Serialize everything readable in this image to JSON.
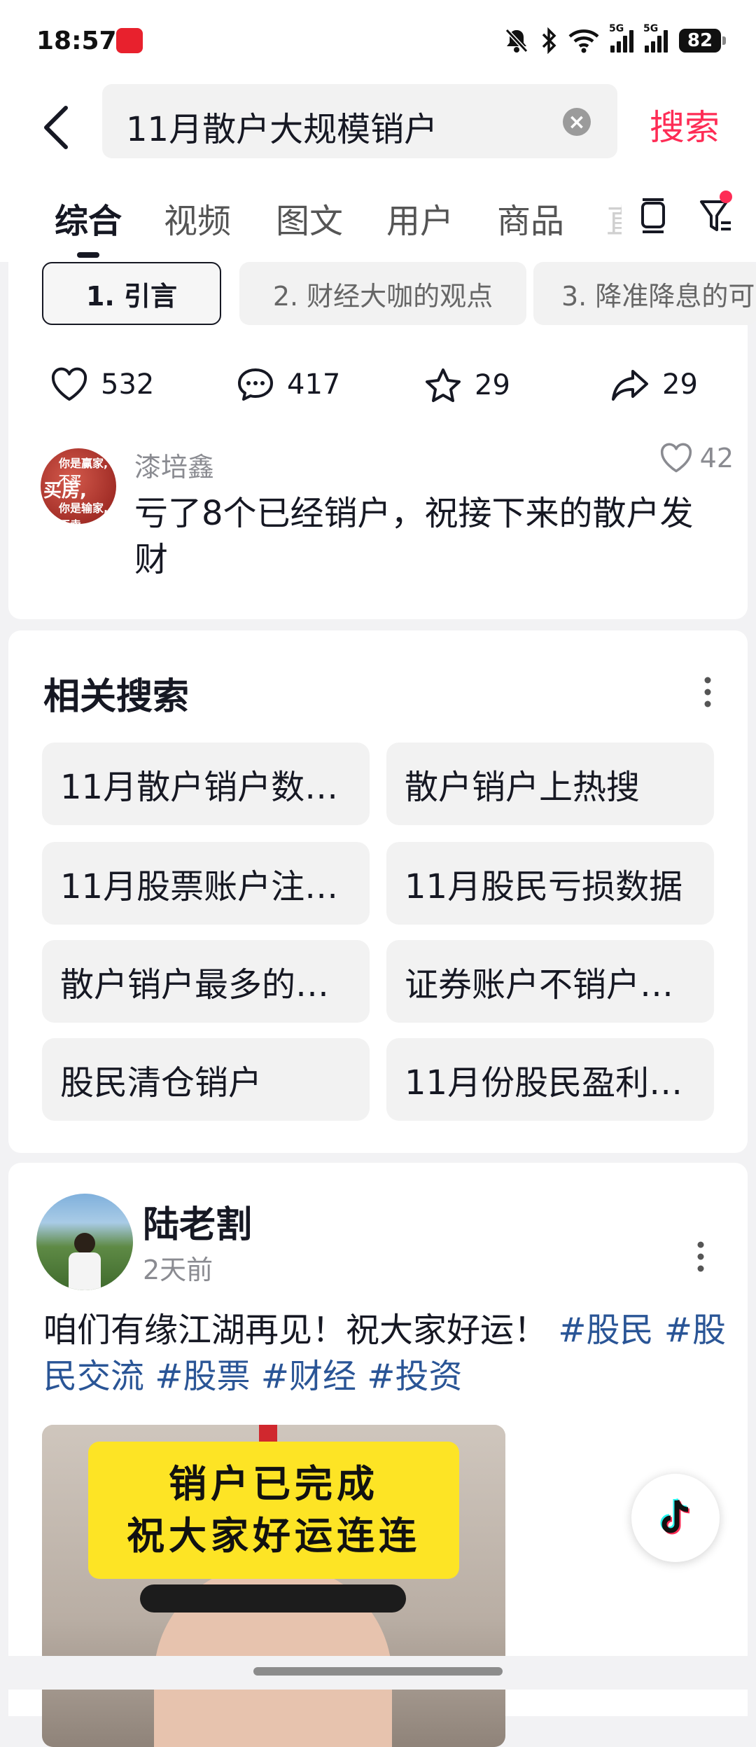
{
  "status_bar": {
    "time": "18:57",
    "battery": "82",
    "network_labels": [
      "5G",
      "5G"
    ],
    "icons": [
      "notification-muted-icon",
      "bluetooth-icon",
      "wifi-icon",
      "signal-icon",
      "signal-icon",
      "battery-icon"
    ]
  },
  "search": {
    "query": "11月散户大规模销户",
    "search_button": "搜索"
  },
  "tabs": [
    {
      "label": "综合",
      "active": true
    },
    {
      "label": "视频"
    },
    {
      "label": "图文"
    },
    {
      "label": "用户"
    },
    {
      "label": "商品"
    }
  ],
  "tab_partial": "直",
  "chapters": [
    "1. 引言",
    "2. 财经大咖的观点",
    "3. 降准降息的可"
  ],
  "actions": {
    "likes": "532",
    "comments": "417",
    "favorites": "29",
    "shares": "29"
  },
  "top_comment": {
    "name": "漆培鑫",
    "likes": "42",
    "text": "亏了8个已经销户，祝接下来的散户发财",
    "avatar_text": [
      "买房,",
      "你是赢家, 不买",
      "你是输家, 不卖"
    ]
  },
  "related": {
    "title": "相关搜索",
    "items": [
      "11月散户销户数…",
      "散户销户上热搜",
      "11月股票账户注…",
      "11月股民亏损数据",
      "散户销户最多的…",
      "证券账户不销户…",
      "股民清仓销户",
      "11月份股民盈利…"
    ]
  },
  "post": {
    "author": "陆老割",
    "time": "2天前",
    "text": "咱们有缘江湖再见！祝大家好运！",
    "tags": [
      "#股民",
      "#股民交流",
      "#股票",
      "#财经",
      "#投资"
    ],
    "image_banner": [
      "销户已完成",
      "祝大家好运连连"
    ]
  },
  "colors": {
    "accent": "#fe2c55",
    "tag": "#2a5596",
    "banner": "#fde425"
  }
}
